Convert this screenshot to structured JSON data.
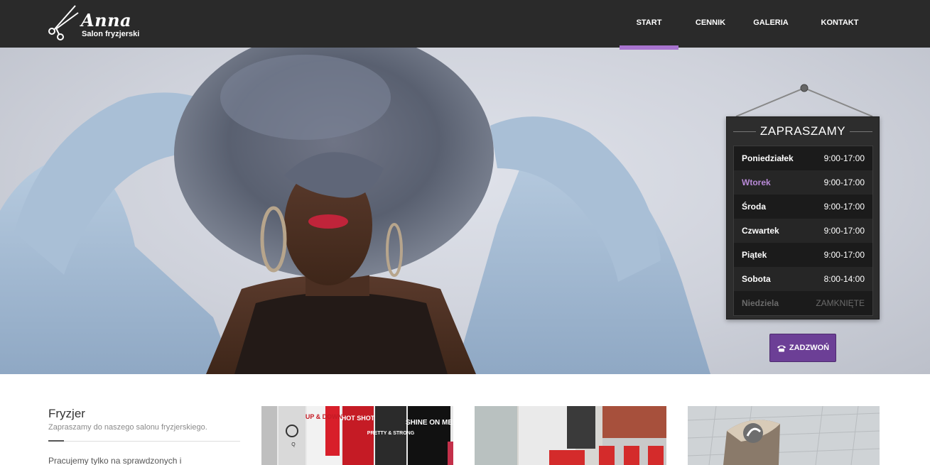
{
  "header": {
    "brand_name": "Anna",
    "brand_tagline": "Salon fryzjerski",
    "logo_icon": "scissors-icon",
    "nav": [
      {
        "label": "START",
        "active": true
      },
      {
        "label": "CENNIK",
        "active": false
      },
      {
        "label": "GALERIA",
        "active": false
      },
      {
        "label": "KONTAKT",
        "active": false
      }
    ]
  },
  "hours": {
    "title": "ZAPRASZAMY",
    "days": [
      {
        "day": "Poniedziałek",
        "time": "9:00-17:00"
      },
      {
        "day": "Wtorek",
        "time": "9:00-17:00"
      },
      {
        "day": "Środa",
        "time": "9:00-17:00"
      },
      {
        "day": "Czwartek",
        "time": "9:00-17:00"
      },
      {
        "day": "Piątek",
        "time": "9:00-17:00"
      },
      {
        "day": "Sobota",
        "time": "8:00-14:00"
      },
      {
        "day": "Niedziela",
        "time": "ZAMKNIĘTE"
      }
    ],
    "highlight_color": "#b98ad8"
  },
  "call_button": {
    "label": "ZADZWOŃ",
    "icon": "phone-icon"
  },
  "intro": {
    "heading": "Fryzjer",
    "subheading": "Zapraszamy do naszego salonu fryzjerskiego.",
    "text": "Pracujemy tylko na sprawdzonych i"
  },
  "products_thumb": {
    "cans": [
      "Q",
      "UP & DOWN",
      "HOT SHOT",
      "PRETTY & STRONG",
      "SHINE ON ME"
    ]
  },
  "colors": {
    "header_bg": "#2a2a2a",
    "accent": "#a874cf",
    "button": "#6c3f96"
  }
}
